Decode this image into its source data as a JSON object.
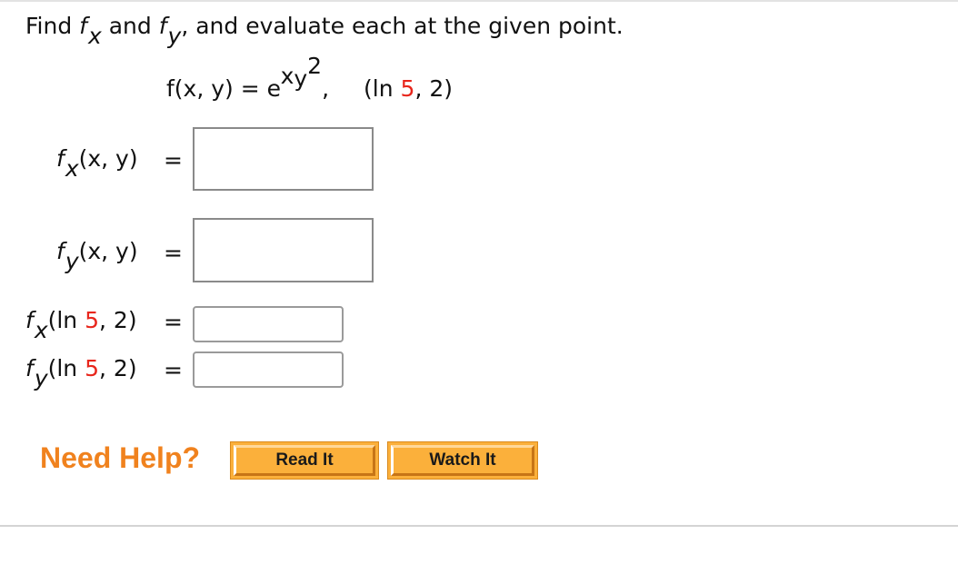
{
  "problem": {
    "prompt": {
      "find": "Find ",
      "f": "f",
      "x": "x",
      "and": " and ",
      "y": "y",
      "rest": ", and evaluate each at the given point."
    },
    "function": {
      "lhs": "f(x, y) = e",
      "exp_x": "x",
      "base_y": "y",
      "exp_2": "2",
      "comma": ",",
      "point_open": "(ln ",
      "point_value": "5",
      "point_close": ", 2)"
    }
  },
  "rows": {
    "fx": {
      "f": "f",
      "sub": "x",
      "args": "(x, y)",
      "eq": "="
    },
    "fy": {
      "f": "f",
      "sub": "y",
      "args": "(x, y)",
      "eq": "="
    },
    "fx_eval": {
      "f": "f",
      "sub": "x",
      "open": "(ln ",
      "value": "5",
      "close": ", 2)",
      "eq": "="
    },
    "fy_eval": {
      "f": "f",
      "sub": "y",
      "open": "(ln ",
      "value": "5",
      "close": ", 2)",
      "eq": "="
    }
  },
  "help": {
    "label": "Need Help?",
    "read_it": "Read It",
    "watch_it": "Watch It"
  },
  "colors": {
    "accent_red": "#e8261c",
    "help_orange": "#f0821e",
    "button_orange": "#fbb03b"
  }
}
